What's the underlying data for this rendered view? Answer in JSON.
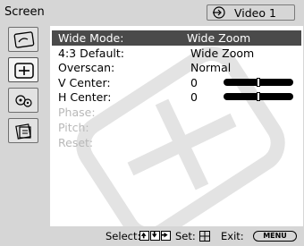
{
  "header": {
    "title": "Screen",
    "input_label": "Video 1",
    "input_icon": "input-arrow-icon"
  },
  "sidebar": {
    "icons": [
      {
        "name": "picture-icon",
        "selected": false
      },
      {
        "name": "screen-icon",
        "selected": true
      },
      {
        "name": "setup-icon",
        "selected": false
      },
      {
        "name": "options-icon",
        "selected": false
      }
    ]
  },
  "menu": {
    "rows": [
      {
        "label": "Wide Mode:",
        "value": "Wide Zoom",
        "highlighted": true
      },
      {
        "label": "4:3 Default:",
        "value": "Wide Zoom"
      },
      {
        "label": "Overscan:",
        "value": "Normal"
      },
      {
        "label": "V Center:",
        "value": "0",
        "slider_level": 0.5
      },
      {
        "label": "H Center:",
        "value": "0",
        "slider_level": 0.5
      },
      {
        "label": "Phase:",
        "disabled": true
      },
      {
        "label": "Pitch:",
        "disabled": true
      },
      {
        "label": "Reset:",
        "disabled": true
      }
    ]
  },
  "footer": {
    "select_label": "Select:",
    "set_label": "Set:",
    "exit_label": "Exit:",
    "menu_button": "MENU"
  },
  "colors": {
    "background": "#d6d6d6",
    "panel": "#ffffff",
    "highlight": "#4a4a4a",
    "disabled_text": "#b8b8b8"
  }
}
